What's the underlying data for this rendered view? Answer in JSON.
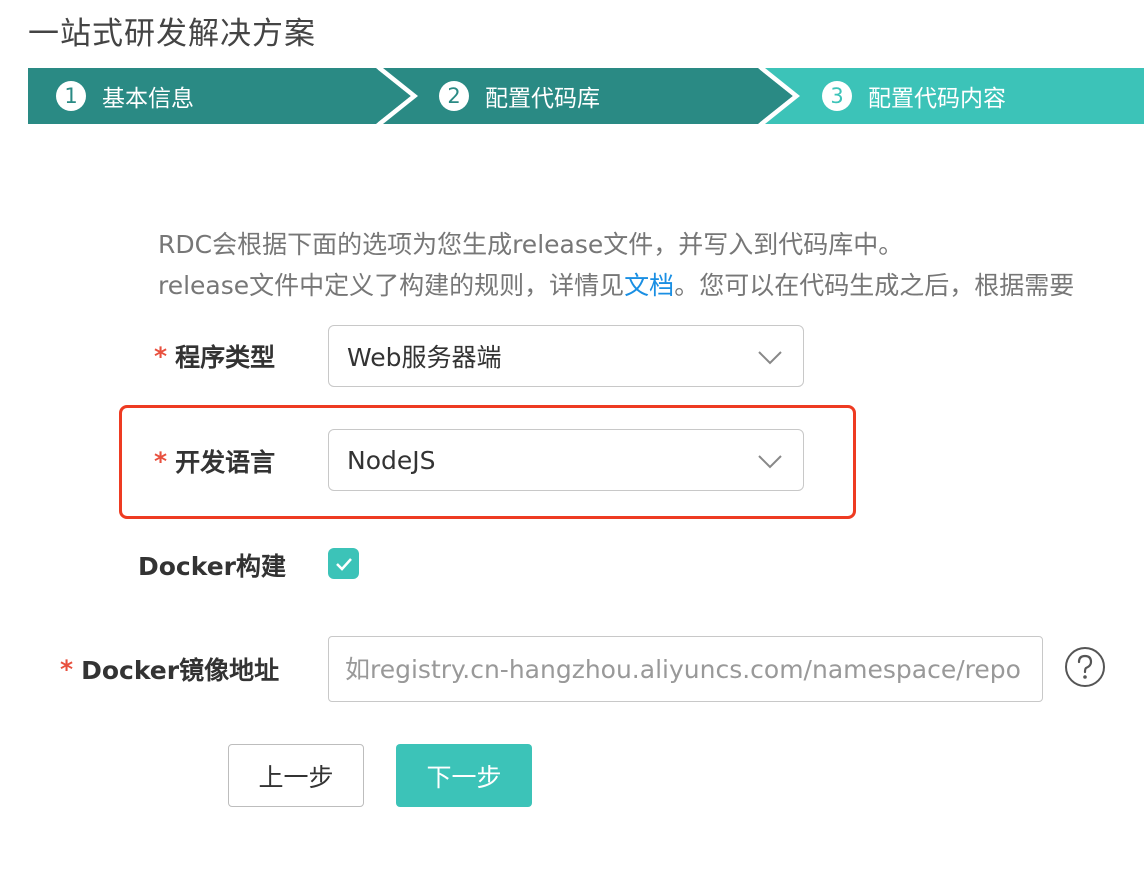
{
  "page": {
    "title": "一站式研发解决方案"
  },
  "steps": [
    {
      "num": "1",
      "label": "基本信息"
    },
    {
      "num": "2",
      "label": "配置代码库"
    },
    {
      "num": "3",
      "label": "配置代码内容"
    }
  ],
  "description": {
    "line1": "RDC会根据下面的选项为您生成release文件，并写入到代码库中。",
    "line2_before": "release文件中定义了构建的规则，详情见",
    "line2_link": "文档",
    "line2_after": "。您可以在代码生成之后，根据需要"
  },
  "form": {
    "program_type": {
      "label": "程序类型",
      "value": "Web服务器端"
    },
    "language": {
      "label": "开发语言",
      "value": "NodeJS"
    },
    "docker_build": {
      "label": "Docker构建",
      "checked": true
    },
    "docker_image": {
      "label": "Docker镜像地址",
      "placeholder": "如registry.cn-hangzhou.aliyuncs.com/namespace/repo",
      "value": ""
    },
    "required_mark": "*"
  },
  "buttons": {
    "prev": "上一步",
    "next": "下一步"
  },
  "colors": {
    "step_done": "#2a8a84",
    "step_active": "#3cc3b8",
    "accent": "#3cc3b8",
    "highlight": "#ee3b22",
    "link": "#1a8fe3"
  },
  "icons": {
    "select_arrow": "chevron-down-icon",
    "checkbox": "check-icon",
    "help": "question-circle-icon"
  }
}
